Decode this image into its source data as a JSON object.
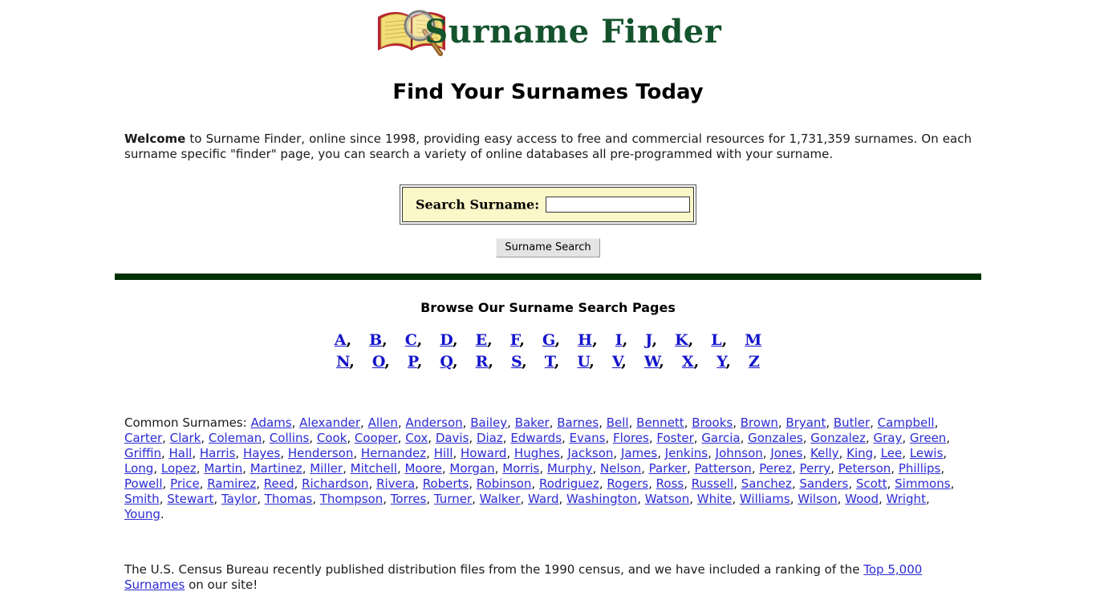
{
  "header": {
    "site_title": "Surname Finder",
    "logo_icon": "open-book-magnifier-icon",
    "tagline": "Find Your Surnames Today"
  },
  "intro": {
    "lead": "Welcome",
    "body": " to Surname Finder, online since 1998, providing easy access to free and commercial resources for 1,731,359 surnames. On each surname specific \"finder\" page, you can search a variety of online databases all pre-programmed with your surname.",
    "online_since": "1998",
    "surname_count": "1,731,359"
  },
  "search": {
    "label": "Search Surname:",
    "value": "",
    "placeholder": "",
    "button_label": "Surname Search",
    "box_background": "#fbf7c8"
  },
  "divider": {
    "color": "#023005"
  },
  "browse": {
    "heading": "Browse Our Surname Search Pages",
    "letters_row1": [
      "A",
      "B",
      "C",
      "D",
      "E",
      "F",
      "G",
      "H",
      "I",
      "J",
      "K",
      "L",
      "M"
    ],
    "letters_row2": [
      "N",
      "O",
      "P",
      "Q",
      "R",
      "S",
      "T",
      "U",
      "V",
      "W",
      "X",
      "Y",
      "Z"
    ],
    "separator": ","
  },
  "common_surnames": {
    "label": "Common Surnames:",
    "terminator": ".",
    "names": [
      "Adams",
      "Alexander",
      "Allen",
      "Anderson",
      "Bailey",
      "Baker",
      "Barnes",
      "Bell",
      "Bennett",
      "Brooks",
      "Brown",
      "Bryant",
      "Butler",
      "Campbell",
      "Carter",
      "Clark",
      "Coleman",
      "Collins",
      "Cook",
      "Cooper",
      "Cox",
      "Davis",
      "Diaz",
      "Edwards",
      "Evans",
      "Flores",
      "Foster",
      "Garcia",
      "Gonzales",
      "Gonzalez",
      "Gray",
      "Green",
      "Griffin",
      "Hall",
      "Harris",
      "Hayes",
      "Henderson",
      "Hernandez",
      "Hill",
      "Howard",
      "Hughes",
      "Jackson",
      "James",
      "Jenkins",
      "Johnson",
      "Jones",
      "Kelly",
      "King",
      "Lee",
      "Lewis",
      "Long",
      "Lopez",
      "Martin",
      "Martinez",
      "Miller",
      "Mitchell",
      "Moore",
      "Morgan",
      "Morris",
      "Murphy",
      "Nelson",
      "Parker",
      "Patterson",
      "Perez",
      "Perry",
      "Peterson",
      "Phillips",
      "Powell",
      "Price",
      "Ramirez",
      "Reed",
      "Richardson",
      "Rivera",
      "Roberts",
      "Robinson",
      "Rodriguez",
      "Rogers",
      "Ross",
      "Russell",
      "Sanchez",
      "Sanders",
      "Scott",
      "Simmons",
      "Smith",
      "Stewart",
      "Taylor",
      "Thomas",
      "Thompson",
      "Torres",
      "Turner",
      "Walker",
      "Ward",
      "Washington",
      "Watson",
      "White",
      "Williams",
      "Wilson",
      "Wood",
      "Wright",
      "Young"
    ]
  },
  "census_note": {
    "text_before": "The U.S. Census Bureau recently published distribution files from the 1990 census, and we have included a ranking of the ",
    "link_text": "Top 5,000 Surnames",
    "text_after": " on our site!",
    "census_year": "1990"
  }
}
